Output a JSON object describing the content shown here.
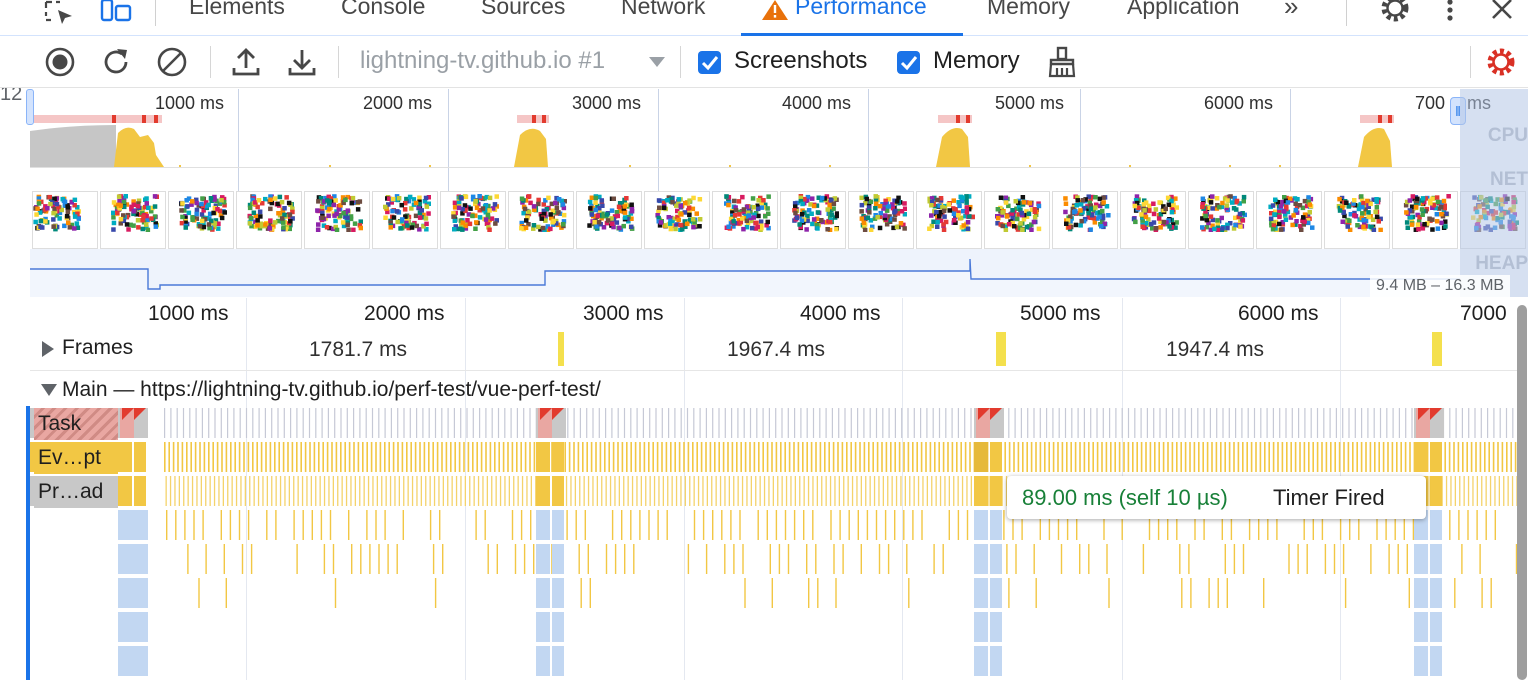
{
  "tabs": [
    {
      "label": "Elements",
      "active": false
    },
    {
      "label": "Console",
      "active": false
    },
    {
      "label": "Sources",
      "active": false
    },
    {
      "label": "Network",
      "active": false
    },
    {
      "label": "Performance",
      "active": true,
      "warning": true
    },
    {
      "label": "Memory",
      "active": false
    },
    {
      "label": "Application",
      "active": false
    }
  ],
  "more_tabs_glyph": "»",
  "toolbar": {
    "profile_select": "lightning-tv.github.io #1",
    "screenshots_label": "Screenshots",
    "screenshots_checked": true,
    "memory_label": "Memory",
    "memory_checked": true
  },
  "side_counter": "12",
  "overview": {
    "ticks": [
      "1000 ms",
      "2000 ms",
      "3000 ms",
      "4000 ms",
      "5000 ms",
      "6000 ms",
      "700",
      "ms"
    ],
    "cpu_label": "CPU",
    "net_label": "NET",
    "heap_label": "HEAP",
    "heap_range": "9.4 MB – 16.3 MB"
  },
  "timeline": {
    "ticks": [
      "1000 ms",
      "2000 ms",
      "3000 ms",
      "4000 ms",
      "5000 ms",
      "6000 ms",
      "7000"
    ],
    "frames_label": "Frames",
    "frame_durations": [
      "1781.7 ms",
      "1967.4 ms",
      "1947.4 ms"
    ],
    "main_label": "Main — https://lightning-tv.github.io/perf-test/vue-perf-test/",
    "rows": [
      "Task",
      "Ev…pt",
      "Pr…ad"
    ]
  },
  "tooltip": {
    "duration": "89.00 ms (self 10 µs)",
    "name": "Timer Fired"
  },
  "colors": {
    "accent": "#1a73e8",
    "scripting": "#f2c744",
    "task": "#c8c8c8",
    "long_task_red": "#e23b2e",
    "compile": "#c2d7f2",
    "tooltip_green": "#188038",
    "settings_red": "#d93025",
    "warning_orange": "#e8710a"
  }
}
